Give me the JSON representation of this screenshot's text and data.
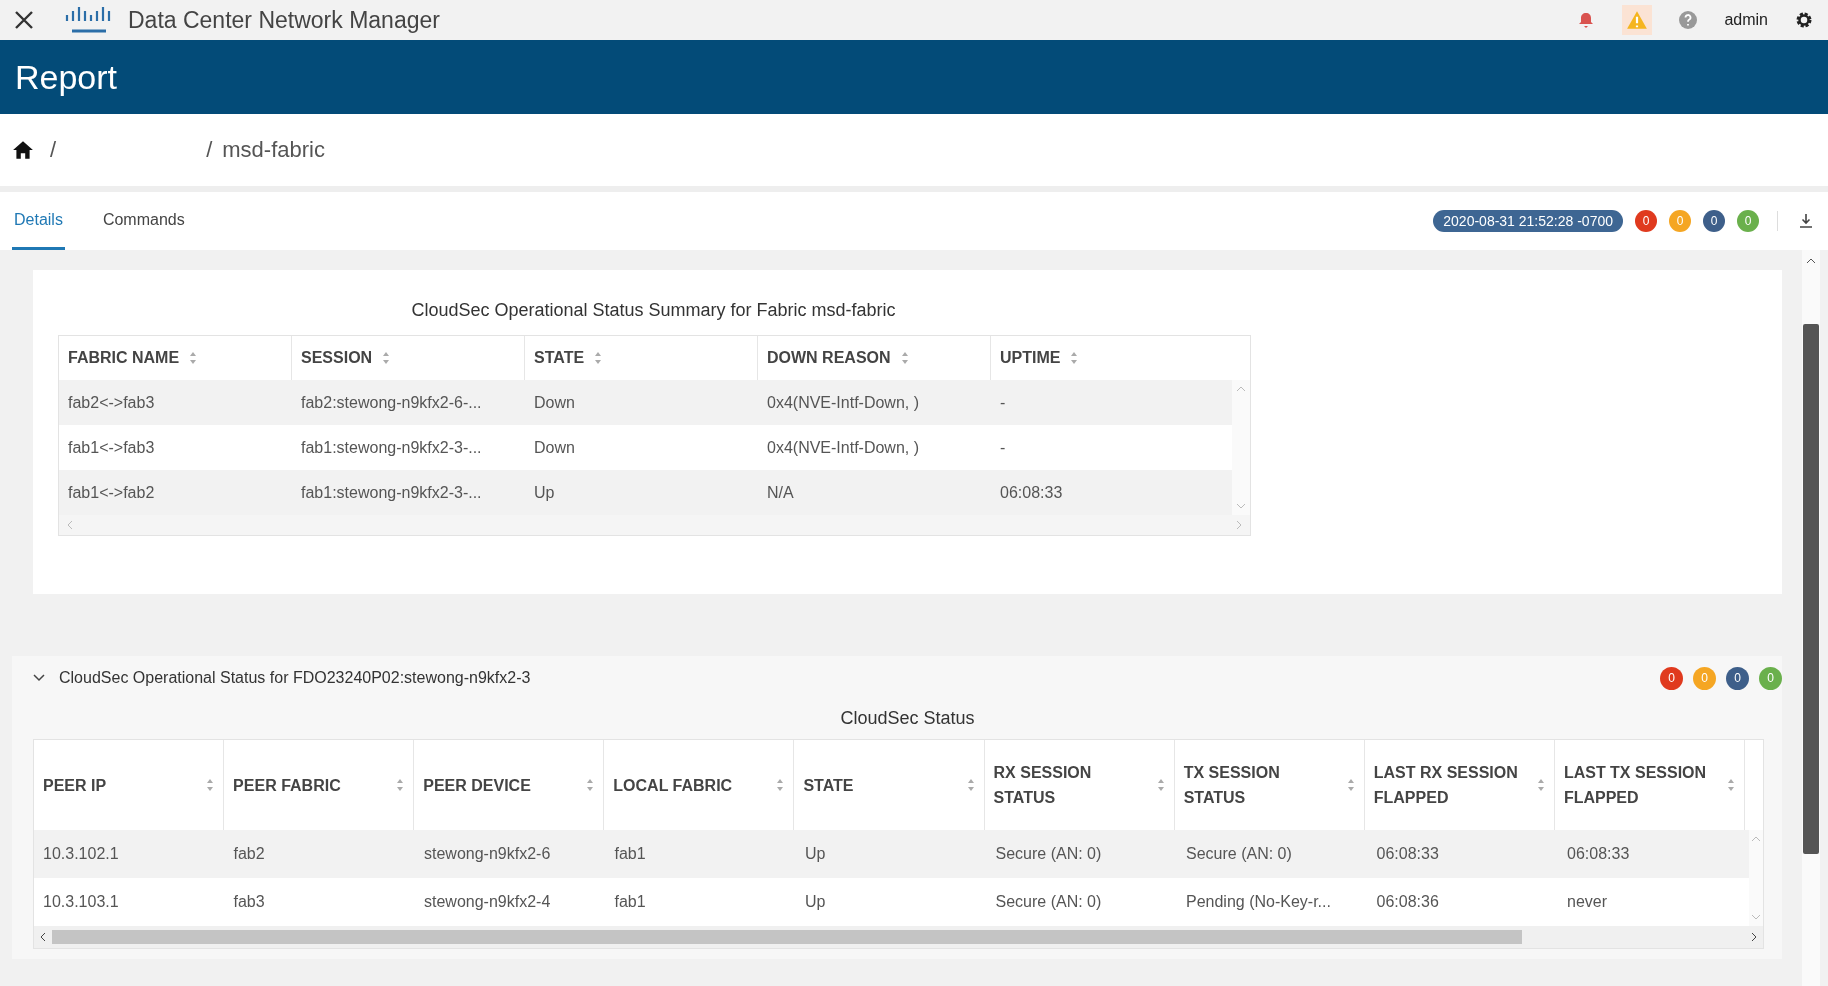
{
  "topbar": {
    "title": "Data Center Network Manager",
    "user": "admin"
  },
  "page_title": "Report",
  "breadcrumb": {
    "parts": [
      "/",
      "/",
      "msd-fabric"
    ]
  },
  "tabs": [
    {
      "label": "Details",
      "selected": true
    },
    {
      "label": "Commands",
      "selected": false
    }
  ],
  "timestamp": "2020-08-31 21:52:28 -0700",
  "counts": [
    {
      "value": "0",
      "color": "#e03a1e"
    },
    {
      "value": "0",
      "color": "#f5a623"
    },
    {
      "value": "0",
      "color": "#3e5f8a"
    },
    {
      "value": "0",
      "color": "#6ab04c"
    }
  ],
  "summary": {
    "title": "CloudSec Operational Status Summary for Fabric msd-fabric",
    "columns": [
      "FABRIC NAME",
      "SESSION",
      "STATE",
      "DOWN REASON",
      "UPTIME"
    ],
    "rows": [
      [
        "fab2<->fab3",
        "fab2:stewong-n9kfx2-6-...",
        "Down",
        "0x4(NVE-Intf-Down, )",
        "-"
      ],
      [
        "fab1<->fab3",
        "fab1:stewong-n9kfx2-3-...",
        "Down",
        "0x4(NVE-Intf-Down, )",
        "-"
      ],
      [
        "fab1<->fab2",
        "fab1:stewong-n9kfx2-3-...",
        "Up",
        "N/A",
        "06:08:33"
      ]
    ]
  },
  "section": {
    "title": "CloudSec Operational Status for FDO23240P02:stewong-n9kfx2-3",
    "expanded": true,
    "counts": [
      {
        "value": "0",
        "color": "#e03a1e"
      },
      {
        "value": "0",
        "color": "#f5a623"
      },
      {
        "value": "0",
        "color": "#3e5f8a"
      },
      {
        "value": "0",
        "color": "#6ab04c"
      }
    ],
    "table_title": "CloudSec Status",
    "columns": [
      "PEER IP",
      "PEER FABRIC",
      "PEER DEVICE",
      "LOCAL FABRIC",
      "STATE",
      "RX SESSION STATUS",
      "TX SESSION STATUS",
      "LAST RX SESSION FLAPPED",
      "LAST TX SESSION FLAPPED"
    ],
    "rows": [
      [
        "10.3.102.1",
        "fab2",
        "stewong-n9kfx2-6",
        "fab1",
        "Up",
        "Secure (AN: 0)",
        "Secure (AN: 0)",
        "06:08:33",
        "06:08:33"
      ],
      [
        "10.3.103.1",
        "fab3",
        "stewong-n9kfx2-4",
        "fab1",
        "Up",
        "Secure (AN: 0)",
        "Pending (No-Key-r...",
        "06:08:36",
        "never"
      ]
    ]
  }
}
